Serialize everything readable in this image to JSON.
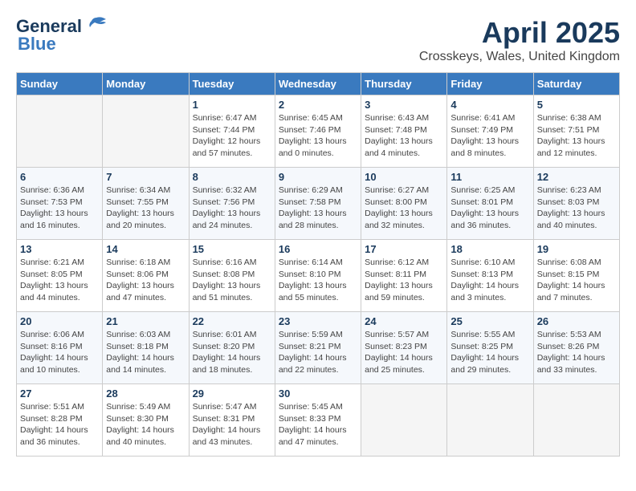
{
  "header": {
    "logo_general": "General",
    "logo_blue": "Blue",
    "title": "April 2025",
    "subtitle": "Crosskeys, Wales, United Kingdom"
  },
  "columns": [
    "Sunday",
    "Monday",
    "Tuesday",
    "Wednesday",
    "Thursday",
    "Friday",
    "Saturday"
  ],
  "weeks": [
    [
      {
        "day": "",
        "info": ""
      },
      {
        "day": "",
        "info": ""
      },
      {
        "day": "1",
        "info": "Sunrise: 6:47 AM\nSunset: 7:44 PM\nDaylight: 12 hours and 57 minutes."
      },
      {
        "day": "2",
        "info": "Sunrise: 6:45 AM\nSunset: 7:46 PM\nDaylight: 13 hours and 0 minutes."
      },
      {
        "day": "3",
        "info": "Sunrise: 6:43 AM\nSunset: 7:48 PM\nDaylight: 13 hours and 4 minutes."
      },
      {
        "day": "4",
        "info": "Sunrise: 6:41 AM\nSunset: 7:49 PM\nDaylight: 13 hours and 8 minutes."
      },
      {
        "day": "5",
        "info": "Sunrise: 6:38 AM\nSunset: 7:51 PM\nDaylight: 13 hours and 12 minutes."
      }
    ],
    [
      {
        "day": "6",
        "info": "Sunrise: 6:36 AM\nSunset: 7:53 PM\nDaylight: 13 hours and 16 minutes."
      },
      {
        "day": "7",
        "info": "Sunrise: 6:34 AM\nSunset: 7:55 PM\nDaylight: 13 hours and 20 minutes."
      },
      {
        "day": "8",
        "info": "Sunrise: 6:32 AM\nSunset: 7:56 PM\nDaylight: 13 hours and 24 minutes."
      },
      {
        "day": "9",
        "info": "Sunrise: 6:29 AM\nSunset: 7:58 PM\nDaylight: 13 hours and 28 minutes."
      },
      {
        "day": "10",
        "info": "Sunrise: 6:27 AM\nSunset: 8:00 PM\nDaylight: 13 hours and 32 minutes."
      },
      {
        "day": "11",
        "info": "Sunrise: 6:25 AM\nSunset: 8:01 PM\nDaylight: 13 hours and 36 minutes."
      },
      {
        "day": "12",
        "info": "Sunrise: 6:23 AM\nSunset: 8:03 PM\nDaylight: 13 hours and 40 minutes."
      }
    ],
    [
      {
        "day": "13",
        "info": "Sunrise: 6:21 AM\nSunset: 8:05 PM\nDaylight: 13 hours and 44 minutes."
      },
      {
        "day": "14",
        "info": "Sunrise: 6:18 AM\nSunset: 8:06 PM\nDaylight: 13 hours and 47 minutes."
      },
      {
        "day": "15",
        "info": "Sunrise: 6:16 AM\nSunset: 8:08 PM\nDaylight: 13 hours and 51 minutes."
      },
      {
        "day": "16",
        "info": "Sunrise: 6:14 AM\nSunset: 8:10 PM\nDaylight: 13 hours and 55 minutes."
      },
      {
        "day": "17",
        "info": "Sunrise: 6:12 AM\nSunset: 8:11 PM\nDaylight: 13 hours and 59 minutes."
      },
      {
        "day": "18",
        "info": "Sunrise: 6:10 AM\nSunset: 8:13 PM\nDaylight: 14 hours and 3 minutes."
      },
      {
        "day": "19",
        "info": "Sunrise: 6:08 AM\nSunset: 8:15 PM\nDaylight: 14 hours and 7 minutes."
      }
    ],
    [
      {
        "day": "20",
        "info": "Sunrise: 6:06 AM\nSunset: 8:16 PM\nDaylight: 14 hours and 10 minutes."
      },
      {
        "day": "21",
        "info": "Sunrise: 6:03 AM\nSunset: 8:18 PM\nDaylight: 14 hours and 14 minutes."
      },
      {
        "day": "22",
        "info": "Sunrise: 6:01 AM\nSunset: 8:20 PM\nDaylight: 14 hours and 18 minutes."
      },
      {
        "day": "23",
        "info": "Sunrise: 5:59 AM\nSunset: 8:21 PM\nDaylight: 14 hours and 22 minutes."
      },
      {
        "day": "24",
        "info": "Sunrise: 5:57 AM\nSunset: 8:23 PM\nDaylight: 14 hours and 25 minutes."
      },
      {
        "day": "25",
        "info": "Sunrise: 5:55 AM\nSunset: 8:25 PM\nDaylight: 14 hours and 29 minutes."
      },
      {
        "day": "26",
        "info": "Sunrise: 5:53 AM\nSunset: 8:26 PM\nDaylight: 14 hours and 33 minutes."
      }
    ],
    [
      {
        "day": "27",
        "info": "Sunrise: 5:51 AM\nSunset: 8:28 PM\nDaylight: 14 hours and 36 minutes."
      },
      {
        "day": "28",
        "info": "Sunrise: 5:49 AM\nSunset: 8:30 PM\nDaylight: 14 hours and 40 minutes."
      },
      {
        "day": "29",
        "info": "Sunrise: 5:47 AM\nSunset: 8:31 PM\nDaylight: 14 hours and 43 minutes."
      },
      {
        "day": "30",
        "info": "Sunrise: 5:45 AM\nSunset: 8:33 PM\nDaylight: 14 hours and 47 minutes."
      },
      {
        "day": "",
        "info": ""
      },
      {
        "day": "",
        "info": ""
      },
      {
        "day": "",
        "info": ""
      }
    ]
  ]
}
